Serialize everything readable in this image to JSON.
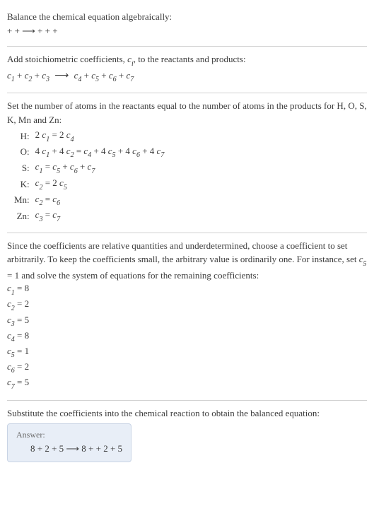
{
  "s1": {
    "title": "Balance the chemical equation algebraically:",
    "reaction": " +  +  ⟶  +  +  + "
  },
  "s2": {
    "title_a": "Add stoichiometric coefficients, ",
    "ci": "c",
    "ci_sub": "i",
    "title_b": ", to the reactants and products:",
    "eq_parts": {
      "c1": "c",
      "c1s": "1",
      "c2": "c",
      "c2s": "2",
      "c3": "c",
      "c3s": "3",
      "c4": "c",
      "c4s": "4",
      "c5": "c",
      "c5s": "5",
      "c6": "c",
      "c6s": "6",
      "c7": "c",
      "c7s": "7",
      "plus": " + ",
      "arrow": "⟶"
    }
  },
  "s3": {
    "title": "Set the number of atoms in the reactants equal to the number of atoms in the products for H, O, S, K, Mn and Zn:",
    "rows": [
      {
        "el": "H:",
        "l1": "2 ",
        "c1": "c",
        "s1": "1",
        "mid": " = 2 ",
        "c2": "c",
        "s2": "4",
        "tail": ""
      },
      {
        "el": "O:",
        "l1": "4 ",
        "c1": "c",
        "s1": "1",
        "mid": " + 4 ",
        "c2": "c",
        "s2": "2",
        "mid2": " = ",
        "c3": "c",
        "s3": "4",
        "mid3": " + 4 ",
        "c4": "c",
        "s4": "5",
        "mid4": " + 4 ",
        "c5": "c",
        "s5": "6",
        "mid5": " + 4 ",
        "c6": "c",
        "s6": "7"
      },
      {
        "el": "S:",
        "l1": "",
        "c1": "c",
        "s1": "1",
        "mid": " = ",
        "c2": "c",
        "s2": "5",
        "mid2": " + ",
        "c3": "c",
        "s3": "6",
        "mid3": " + ",
        "c4": "c",
        "s4": "7"
      },
      {
        "el": "K:",
        "l1": "",
        "c1": "c",
        "s1": "2",
        "mid": " = 2 ",
        "c2": "c",
        "s2": "5"
      },
      {
        "el": "Mn:",
        "l1": "",
        "c1": "c",
        "s1": "2",
        "mid": " = ",
        "c2": "c",
        "s2": "6"
      },
      {
        "el": "Zn:",
        "l1": "",
        "c1": "c",
        "s1": "3",
        "mid": " = ",
        "c2": "c",
        "s2": "7"
      }
    ]
  },
  "s4": {
    "para_a": "Since the coefficients are relative quantities and underdetermined, choose a coefficient to set arbitrarily. To keep the coefficients small, the arbitrary value is ordinarily one. For instance, set ",
    "c5": "c",
    "c5s": "5",
    "para_b": " = 1 and solve the system of equations for the remaining coefficients:",
    "coefs": [
      {
        "c": "c",
        "s": "1",
        "eq": " = 8"
      },
      {
        "c": "c",
        "s": "2",
        "eq": " = 2"
      },
      {
        "c": "c",
        "s": "3",
        "eq": " = 5"
      },
      {
        "c": "c",
        "s": "4",
        "eq": " = 8"
      },
      {
        "c": "c",
        "s": "5",
        "eq": " = 1"
      },
      {
        "c": "c",
        "s": "6",
        "eq": " = 2"
      },
      {
        "c": "c",
        "s": "7",
        "eq": " = 5"
      }
    ]
  },
  "s5": {
    "title": "Substitute the coefficients into the chemical reaction to obtain the balanced equation:",
    "answer_label": "Answer:",
    "answer_eq": "8  + 2  + 5  ⟶ 8  +  + 2  + 5 "
  }
}
